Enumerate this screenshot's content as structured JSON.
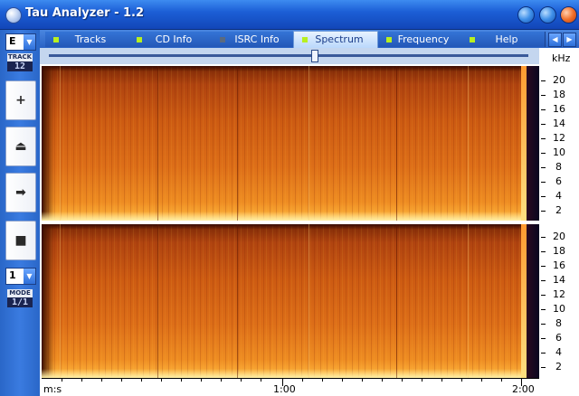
{
  "window": {
    "title": "Tau Analyzer - 1.2"
  },
  "sidebar": {
    "drive_letter": "E",
    "track_label": "TRACK",
    "track_value": "12",
    "buttons": [
      {
        "name": "add",
        "glyph": "+"
      },
      {
        "name": "eject",
        "glyph": "⏏"
      },
      {
        "name": "play",
        "glyph": "➡"
      },
      {
        "name": "stop",
        "glyph": "■"
      }
    ],
    "mode_select_value": "1",
    "mode_label": "MODE",
    "mode_value": "1/1"
  },
  "tabs": [
    {
      "label": "Tracks",
      "active": false,
      "dot": "green"
    },
    {
      "label": "CD Info",
      "active": false,
      "dot": "green"
    },
    {
      "label": "ISRC Info",
      "active": false,
      "dot": "grey"
    },
    {
      "label": "Spectrum",
      "active": true,
      "dot": "green"
    },
    {
      "label": "Frequency",
      "active": false,
      "dot": "green"
    },
    {
      "label": "Help",
      "active": false,
      "dot": "green"
    }
  ],
  "spectrum": {
    "freq_unit": "kHz",
    "freq_ticks": [
      "20",
      "18",
      "16",
      "14",
      "12",
      "10",
      "8",
      "6",
      "4",
      "2"
    ],
    "time_unit": "m:s",
    "time_labels": [
      "1:00",
      "2:00"
    ],
    "channels": 2,
    "colors": {
      "low": "#7a2806",
      "mid": "#dd6e18",
      "high": "#fff0a8"
    }
  }
}
